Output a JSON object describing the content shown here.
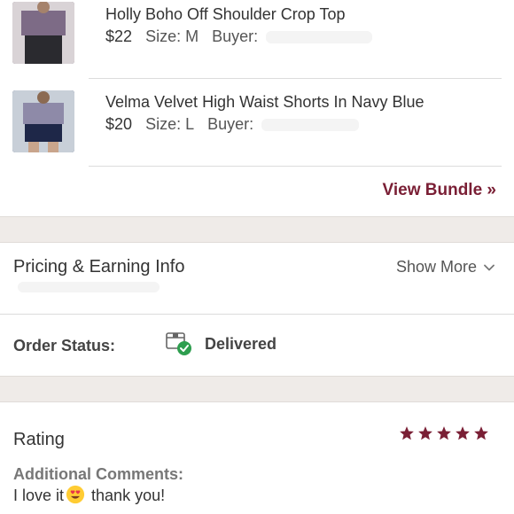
{
  "items": [
    {
      "title": "Holly Boho Off Shoulder Crop Top",
      "price": "$22",
      "size": "Size: M",
      "buyer_label": "Buyer:",
      "thumb_color": "#6a5b6e"
    },
    {
      "title": "Velma Velvet High Waist Shorts In Navy Blue",
      "price": "$20",
      "size": "Size: L",
      "buyer_label": "Buyer:",
      "thumb_color": "#3b4668"
    }
  ],
  "bundle": {
    "view_label": "View Bundle »"
  },
  "pricing": {
    "title": "Pricing & Earning Info",
    "show_more": "Show More"
  },
  "order": {
    "label": "Order Status:",
    "status": "Delivered"
  },
  "rating": {
    "title": "Rating",
    "stars": 5,
    "max_stars": 5
  },
  "comments": {
    "label": "Additional Comments:",
    "text_before": "I love it",
    "text_after": " thank you!",
    "emoji": "heart-eyes-emoji"
  },
  "colors": {
    "accent": "#7a1f35",
    "band": "#efebe8",
    "success": "#2e9e4f"
  }
}
